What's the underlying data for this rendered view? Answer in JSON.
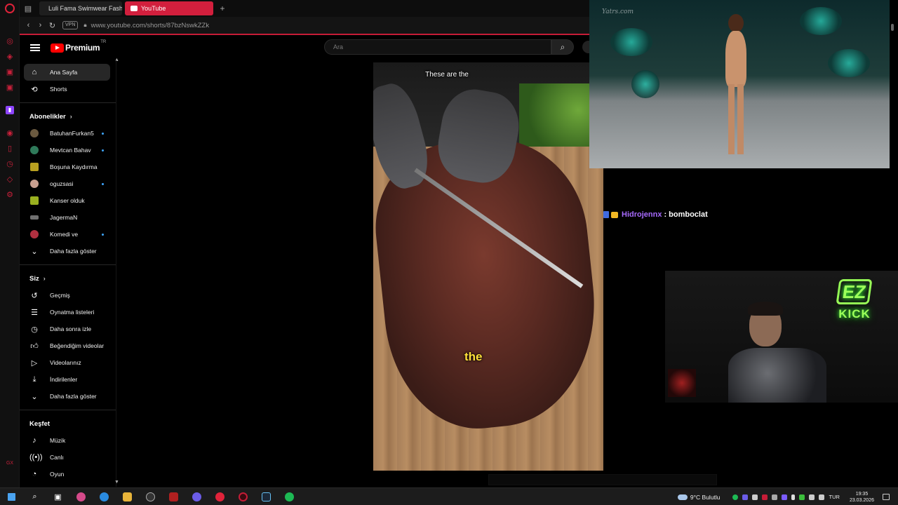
{
  "browser": {
    "tabs": [
      {
        "label": "Luli Fama Swimwear Fashi",
        "active": false
      },
      {
        "label": "YouTube",
        "active": true
      }
    ],
    "address": {
      "vpn": "VPN",
      "url": "www.youtube.com/shorts/87bzNswkZZk"
    }
  },
  "youtube": {
    "logo_text": "Premium",
    "logo_country": "TR",
    "search_placeholder": "Ara",
    "sidebar": {
      "main": [
        {
          "label": "Ana Sayfa",
          "icon": "home-icon"
        },
        {
          "label": "Shorts",
          "icon": "shorts-icon"
        }
      ],
      "subscriptions_title": "Abonelikler",
      "subscriptions": [
        {
          "label": "BatuhanFurkan5",
          "color": "#6b5a40",
          "new": true
        },
        {
          "label": "Mevtcan Bahav",
          "color": "#2f7a5a",
          "new": true
        },
        {
          "label": "Boşuna Kaydırma",
          "color": "#b8a020",
          "new": false
        },
        {
          "label": "oguzsasi",
          "color": "#c9a090",
          "new": true
        },
        {
          "label": "Kanser olduk",
          "color": "#9ab020",
          "new": false
        },
        {
          "label": "JagermaN",
          "color": "#707070",
          "new": false
        },
        {
          "label": "Komedi ve",
          "color": "#b03040",
          "new": true
        }
      ],
      "subscriptions_more": "Daha fazla göster",
      "you_title": "Siz",
      "you": [
        {
          "label": "Geçmiş",
          "icon": "history-icon"
        },
        {
          "label": "Oynatma listeleri",
          "icon": "playlists-icon"
        },
        {
          "label": "Daha sonra izle",
          "icon": "watch-later-icon"
        },
        {
          "label": "Beğendiğim videolar",
          "icon": "like-icon"
        },
        {
          "label": "Videolarınız",
          "icon": "your-videos-icon"
        },
        {
          "label": "İndirilenler",
          "icon": "download-icon"
        }
      ],
      "you_more": "Daha fazla göster",
      "explore_title": "Keşfet",
      "explore": [
        {
          "label": "Müzik",
          "icon": "music-icon"
        },
        {
          "label": "Canlı",
          "icon": "live-icon"
        },
        {
          "label": "Oyun",
          "icon": "gaming-icon"
        }
      ]
    },
    "short": {
      "caption_top": "These are the",
      "caption_word": "the"
    }
  },
  "stream_overlay": {
    "watermark": "Yatrs.com",
    "chat": {
      "user": "Hidrojennx",
      "separator": ":",
      "message": "bomboclat"
    },
    "kick_logo": {
      "top": "EZ",
      "bottom": "KICK"
    }
  },
  "taskbar": {
    "weather": "9°C  Bulutlu",
    "lang": "TUR",
    "time": "19:35",
    "date": "23.03.2026"
  }
}
